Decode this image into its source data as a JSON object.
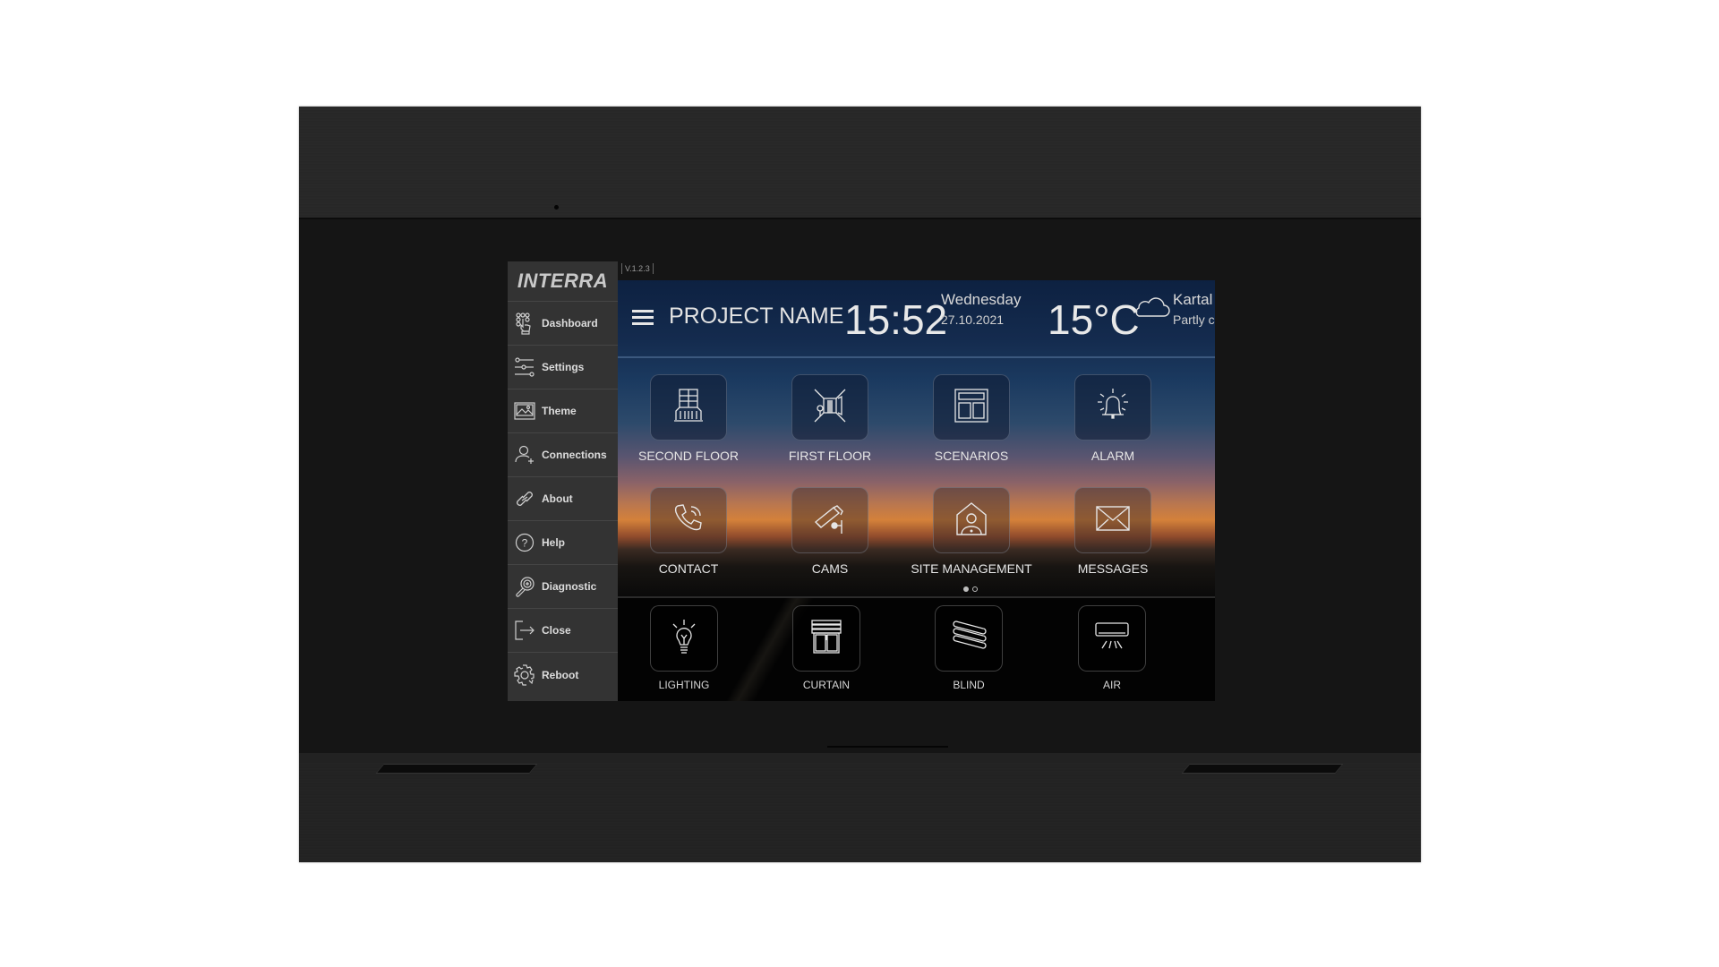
{
  "sidebar": {
    "brand": "INTERRA",
    "items": [
      {
        "label": "Dashboard",
        "icon": "dashboard-hand-icon"
      },
      {
        "label": "Settings",
        "icon": "sliders-icon"
      },
      {
        "label": "Theme",
        "icon": "image-icon"
      },
      {
        "label": "Connections",
        "icon": "user-add-icon"
      },
      {
        "label": "About",
        "icon": "link-icon"
      },
      {
        "label": "Help",
        "icon": "help-circle-icon"
      },
      {
        "label": "Diagnostic",
        "icon": "magnifier-icon"
      },
      {
        "label": "Close",
        "icon": "exit-icon"
      },
      {
        "label": "Reboot",
        "icon": "gear-refresh-icon"
      }
    ]
  },
  "version": "V.1.2.3",
  "header": {
    "project_name": "PROJECT NAME",
    "time": "15:52",
    "day": "Wednesday",
    "date": "27.10.2021",
    "temperature": "15°C",
    "weather_icon": "cloud-icon",
    "city": "Kartal",
    "condition": "Partly cl"
  },
  "tiles": [
    {
      "label": "SECOND FLOOR",
      "icon": "balcony-icon"
    },
    {
      "label": "FIRST FLOOR",
      "icon": "room-door-icon"
    },
    {
      "label": "SCENARIOS",
      "icon": "layout-icon"
    },
    {
      "label": "ALARM",
      "icon": "bell-icon"
    },
    {
      "label": "CONTACT",
      "icon": "phone-icon"
    },
    {
      "label": "CAMS",
      "icon": "security-camera-icon"
    },
    {
      "label": "SITE MANAGEMENT",
      "icon": "house-person-icon"
    },
    {
      "label": "MESSAGES",
      "icon": "envelope-icon"
    }
  ],
  "pager": {
    "current": 1,
    "total": 2
  },
  "dock": [
    {
      "label": "LIGHTING",
      "icon": "light-bulb-icon"
    },
    {
      "label": "CURTAIN",
      "icon": "curtain-icon"
    },
    {
      "label": "BLIND",
      "icon": "blind-icon"
    },
    {
      "label": "AIR",
      "icon": "air-conditioner-icon"
    }
  ]
}
